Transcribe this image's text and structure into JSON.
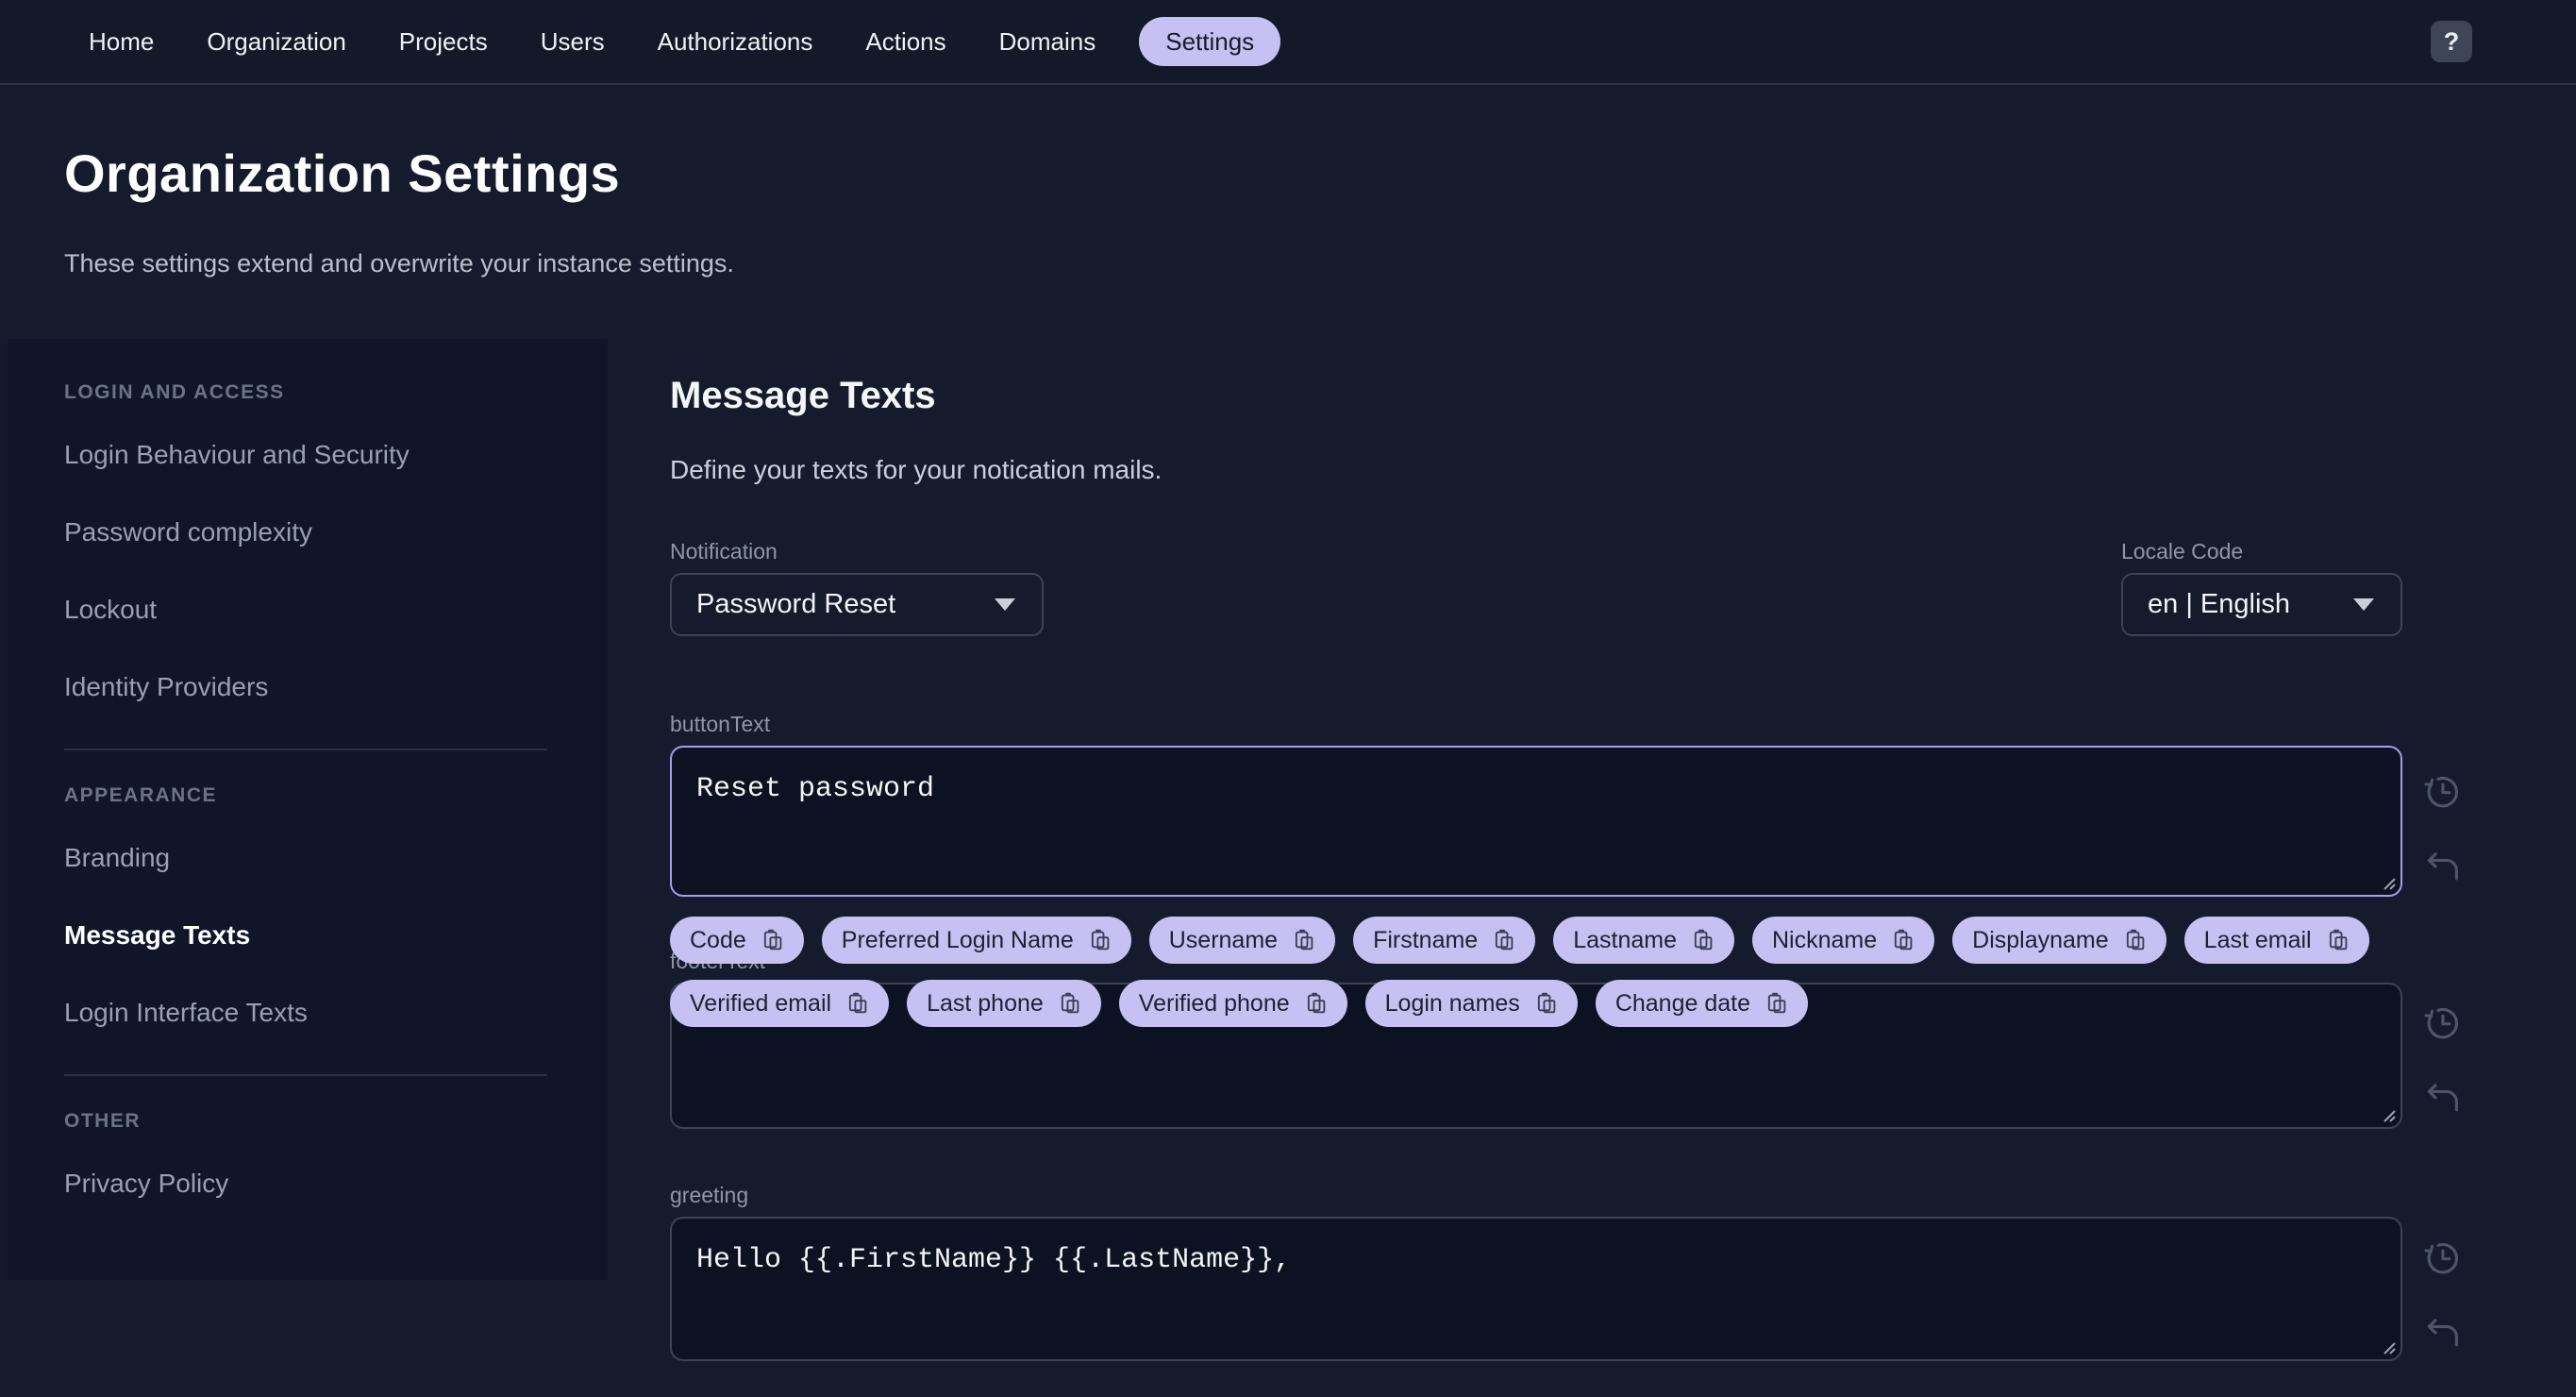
{
  "nav": {
    "items": [
      "Home",
      "Organization",
      "Projects",
      "Users",
      "Authorizations",
      "Actions",
      "Domains"
    ],
    "active_pill": "Settings",
    "help_label": "?"
  },
  "header": {
    "title": "Organization Settings",
    "subtitle": "These settings extend and overwrite your instance settings."
  },
  "sidebar": {
    "sections": [
      {
        "title": "LOGIN AND ACCESS",
        "items": [
          "Login Behaviour and Security",
          "Password complexity",
          "Lockout",
          "Identity Providers"
        ]
      },
      {
        "title": "APPEARANCE",
        "items": [
          "Branding",
          "Message Texts",
          "Login Interface Texts"
        ],
        "active": "Message Texts"
      },
      {
        "title": "OTHER",
        "items": [
          "Privacy Policy"
        ]
      }
    ]
  },
  "main": {
    "heading": "Message Texts",
    "description": "Define your texts for your notication mails.",
    "notification": {
      "label": "Notification",
      "value": "Password Reset"
    },
    "locale": {
      "label": "Locale Code",
      "value": "en | English"
    },
    "fields": [
      {
        "label": "buttonText",
        "value": "Reset password",
        "focused": true
      },
      {
        "label": "footerText",
        "value": "",
        "focused": false
      },
      {
        "label": "greeting",
        "value": "Hello {{.FirstName}} {{.LastName}},",
        "focused": false
      }
    ],
    "chips_row1": [
      "Code",
      "Preferred Login Name",
      "Username",
      "Firstname",
      "Lastname",
      "Nickname",
      "Displayname",
      "Last email"
    ],
    "chips_row2": [
      "Verified email",
      "Last phone",
      "Verified phone",
      "Login names",
      "Change date"
    ]
  },
  "colors": {
    "accent": "#c7c1f3",
    "focus_border": "#a49ef0",
    "background": "#151b2c",
    "panel": "#10152a",
    "field": "#0d1222"
  }
}
